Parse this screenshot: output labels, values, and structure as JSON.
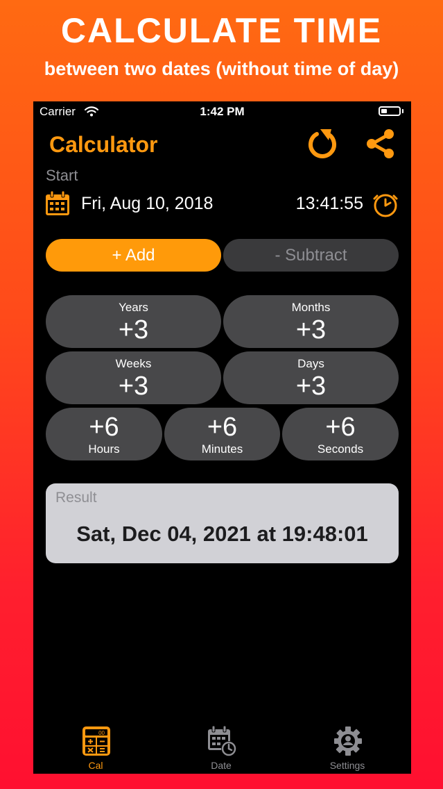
{
  "promo": {
    "title": "CALCULATE TIME",
    "subtitle": "between two dates (without time of day)"
  },
  "status_bar": {
    "carrier": "Carrier",
    "time": "1:42 PM",
    "battery_level": 0.35
  },
  "header": {
    "title": "Calculator",
    "reset_icon": "reset-icon",
    "share_icon": "share-icon"
  },
  "start": {
    "label": "Start",
    "date": "Fri, Aug 10, 2018",
    "time": "13:41:55",
    "calendar_icon": "calendar-icon",
    "clock_icon": "clock-icon"
  },
  "mode": {
    "add_label": "+ Add",
    "subtract_label": "- Subtract",
    "selected": "add"
  },
  "units": {
    "years": {
      "label": "Years",
      "value": "+3"
    },
    "months": {
      "label": "Months",
      "value": "+3"
    },
    "weeks": {
      "label": "Weeks",
      "value": "+3"
    },
    "days": {
      "label": "Days",
      "value": "+3"
    },
    "hours": {
      "label": "Hours",
      "value": "+6"
    },
    "minutes": {
      "label": "Minutes",
      "value": "+6"
    },
    "seconds": {
      "label": "Seconds",
      "value": "+6"
    }
  },
  "result": {
    "label": "Result",
    "value": "Sat, Dec 04, 2021 at 19:48:01"
  },
  "tab_bar": {
    "tabs": [
      {
        "label": "Cal",
        "icon": "calculator-icon",
        "active": true
      },
      {
        "label": "Date",
        "icon": "calendar-clock-icon",
        "active": false
      },
      {
        "label": "Settings",
        "icon": "settings-gear-icon",
        "active": false
      }
    ]
  },
  "colors": {
    "accent": "#ff9910",
    "background": "#000000",
    "button": "#48484a",
    "inactive_tab": "#8e8e93",
    "gradient_top": "#ff6a12",
    "gradient_bottom": "#ff1030"
  }
}
